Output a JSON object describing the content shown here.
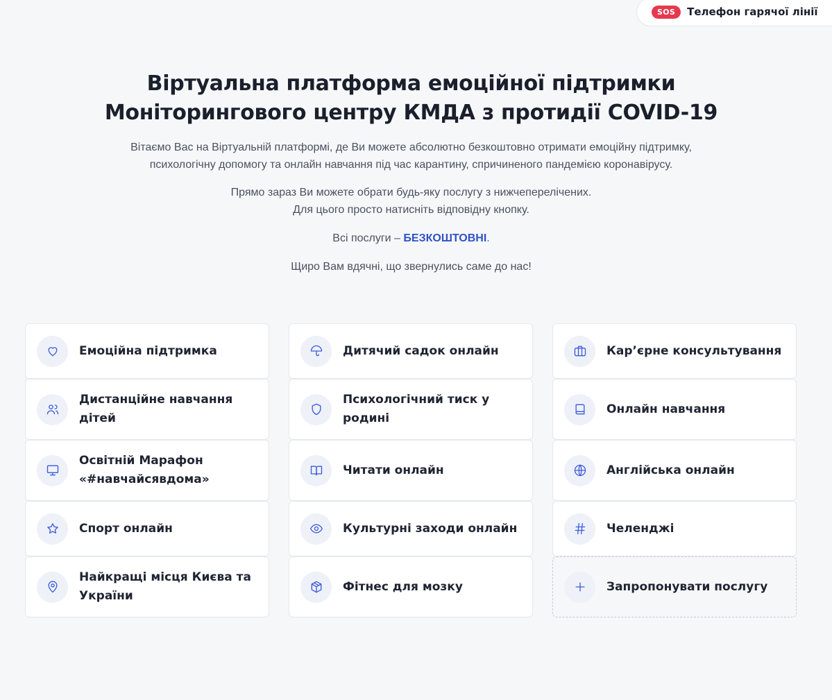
{
  "hotline": {
    "badge": "SOS",
    "label": "Телефон гарячої лінії"
  },
  "intro": {
    "title_line1": "Віртуальна платформа емоційної підтримки",
    "title_line2": "Моніторингового центру КМДА з протидії COVID-19",
    "welcome_line1": "Вітаємо Вас на Віртуальній платформі, де Ви можете абсолютно безкоштовно отримати емоційну підтримку,",
    "welcome_line2": "психологічну допомогу та онлайн навчання під час карантину, спричиненого пандемією коронавірусу.",
    "choose_line1": "Прямо зараз Ви можете обрати будь-яку послугу з нижчеперелічених.",
    "choose_line2": "Для цього просто натисніть відповідну кнопку.",
    "free_prefix": "Всі послуги – ",
    "free_word": "БЕЗКОШТОВНІ",
    "free_suffix": ".",
    "thanks": "Щиро Вам вдячні, що звернулись саме до нас!"
  },
  "colors": {
    "accent": "#2f51c9",
    "sos": "#e53950",
    "icon": "#3b5bdb",
    "icon_bg": "#eef1f8"
  },
  "services": [
    {
      "label": "Емоційна підтримка",
      "icon": "heart-icon"
    },
    {
      "label": "Дитячий садок онлайн",
      "icon": "umbrella-icon"
    },
    {
      "label": "Кар’єрне консультування",
      "icon": "briefcase-icon"
    },
    {
      "label": "Дистанційне навчання дітей",
      "icon": "users-icon"
    },
    {
      "label": "Психологічний тиск у родині",
      "icon": "shield-icon"
    },
    {
      "label": "Онлайн навчання",
      "icon": "book-icon"
    },
    {
      "label": "Освітній Марафон «#навчайсявдома»",
      "icon": "monitor-icon"
    },
    {
      "label": "Читати онлайн",
      "icon": "open-book-icon"
    },
    {
      "label": "Англійська онлайн",
      "icon": "globe-icon"
    },
    {
      "label": "Спорт онлайн",
      "icon": "star-icon"
    },
    {
      "label": "Культурні заходи онлайн",
      "icon": "eye-icon"
    },
    {
      "label": "Челенджі",
      "icon": "hash-icon"
    },
    {
      "label": "Найкращі місця Києва та України",
      "icon": "map-pin-icon"
    },
    {
      "label": "Фітнес для мозку",
      "icon": "box-icon"
    },
    {
      "label": "Запропонувати послугу",
      "icon": "plus-icon"
    }
  ]
}
